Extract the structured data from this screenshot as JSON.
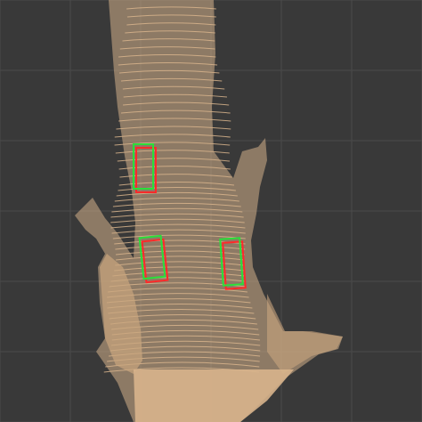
{
  "scene": {
    "background_color": "#393939",
    "grid_color": "#4a4a4a",
    "point_color": "#d8b48c",
    "detections": [
      {
        "label": "",
        "gt_color": "#ff2a2a",
        "pred_color": "#2adf3a"
      },
      {
        "label": "",
        "gt_color": "#ff2a2a",
        "pred_color": "#2adf3a"
      },
      {
        "label": "",
        "gt_color": "#ff2a2a",
        "pred_color": "#2adf3a"
      }
    ]
  }
}
